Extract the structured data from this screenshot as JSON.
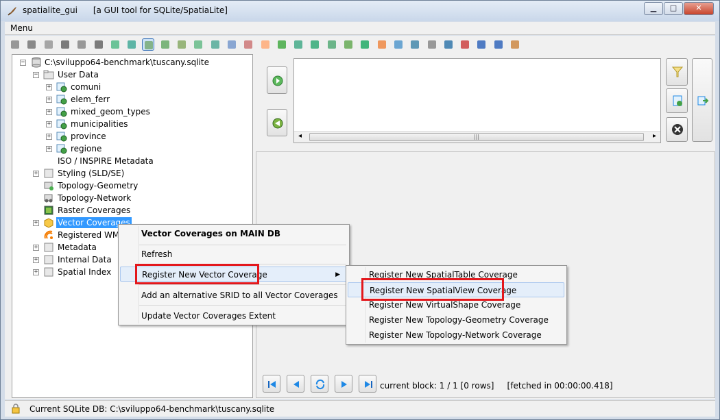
{
  "window": {
    "app_name": "spatialite_gui",
    "subtitle": "[a GUI tool for SQLite/SpatiaLite]",
    "minimize_icon": "minimize-icon",
    "maximize_icon": "maximize-icon",
    "close_icon": "close-icon"
  },
  "menubar": {
    "menu_label": "Menu"
  },
  "tree": {
    "root": "C:\\sviluppo64-benchmark\\tuscany.sqlite",
    "user_data": "User Data",
    "tables": [
      "comuni",
      "elem_ferr",
      "mixed_geom_types",
      "municipalities",
      "province",
      "regione"
    ],
    "iso_metadata": "ISO / INSPIRE Metadata",
    "styling": "Styling (SLD/SE)",
    "topology_geometry": "Topology-Geometry",
    "topology_network": "Topology-Network",
    "raster_coverages": "Raster Coverages",
    "vector_coverages": "Vector Coverages",
    "registered_wms": "Registered WMS",
    "metadata": "Metadata",
    "internal_data": "Internal Data",
    "spatial_index": "Spatial Index"
  },
  "context_menu": {
    "header": "Vector Coverages on MAIN DB",
    "refresh": "Refresh",
    "register_new": "Register New Vector Coverage",
    "add_srid": "Add an alternative SRID to all Vector Coverages",
    "update_extent": "Update Vector Coverages Extent"
  },
  "submenu": {
    "items": [
      "Register New SpatialTable Coverage",
      "Register New SpatialView Coverage",
      "Register New VirtualShape Coverage",
      "Register New Topology-Geometry Coverage",
      "Register New Topology-Network Coverage"
    ]
  },
  "results": {
    "current_block": "current block: 1 / 1 [0 rows]",
    "fetched": "[fetched in 00:00:00.418]"
  },
  "statusbar": {
    "text": "Current SQLite DB: C:\\sviluppo64-benchmark\\tuscany.sqlite"
  },
  "colors": {
    "accent": "#3399ff",
    "highlight_border": "#e3171c"
  }
}
